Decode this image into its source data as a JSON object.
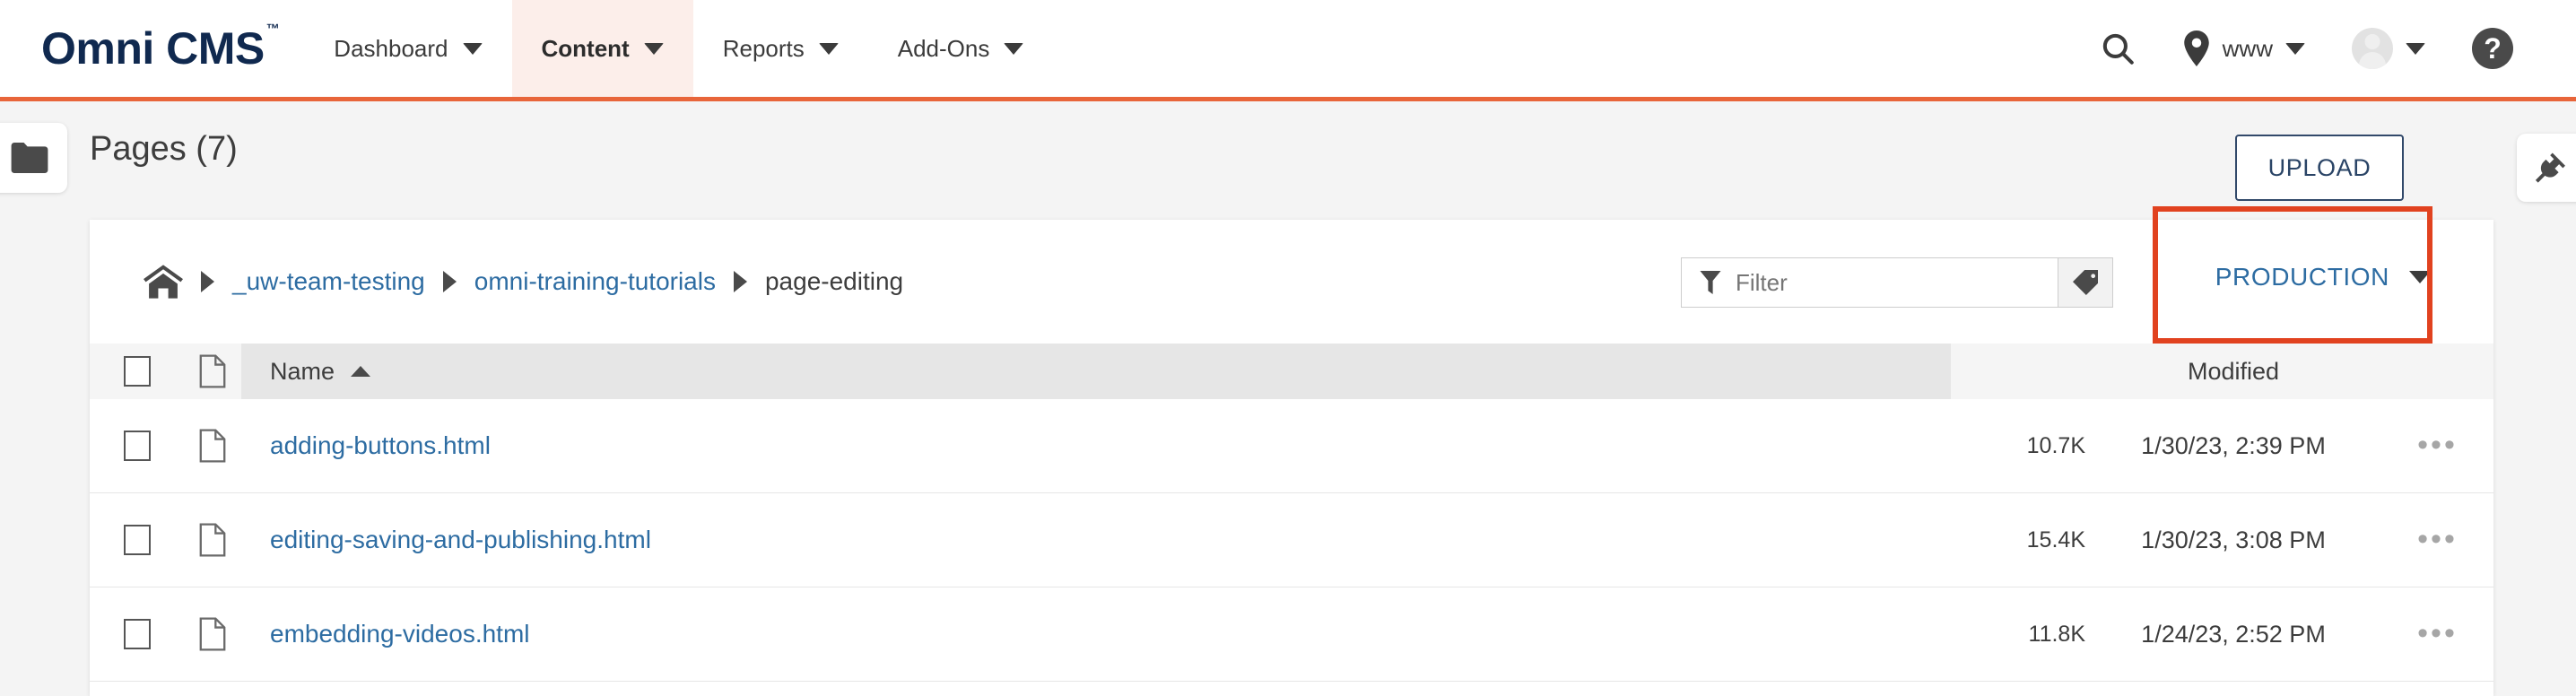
{
  "brand": {
    "name": "Omni CMS",
    "tm": "™"
  },
  "topnav": {
    "items": [
      {
        "label": "Dashboard",
        "active": false
      },
      {
        "label": "Content",
        "active": true
      },
      {
        "label": "Reports",
        "active": false
      },
      {
        "label": "Add-Ons",
        "active": false
      }
    ],
    "search_icon": "search-icon",
    "site_icon": "location-pin-icon",
    "site_label": "www",
    "avatar_icon": "user-avatar",
    "help_icon": "help-question-icon"
  },
  "toolbar": {
    "folder_icon": "folder-icon",
    "title": "Pages (7)",
    "upload_label": "UPLOAD",
    "plugin_icon": "plug-icon"
  },
  "breadcrumb": {
    "home_icon": "home-icon",
    "items": [
      {
        "label": "_uw-team-testing",
        "current": false
      },
      {
        "label": "omni-training-tutorials",
        "current": false
      },
      {
        "label": "page-editing",
        "current": true
      }
    ]
  },
  "filter": {
    "icon": "funnel-icon",
    "placeholder": "Filter",
    "value": "",
    "tag_icon": "tag-icon"
  },
  "environment": {
    "label": "PRODUCTION",
    "caret_icon": "chevron-down-icon",
    "highlight_color": "#e1421f"
  },
  "table": {
    "columns": {
      "name": "Name",
      "size": "",
      "modified": "Modified"
    },
    "sort_icon": "sort-ascending-icon",
    "rows": [
      {
        "name": "adding-buttons.html",
        "size": "10.7K",
        "modified": "1/30/23, 2:39 PM",
        "actions_icon": "more-options-icon"
      },
      {
        "name": "editing-saving-and-publishing.html",
        "size": "15.4K",
        "modified": "1/30/23, 3:08 PM",
        "actions_icon": "more-options-icon"
      },
      {
        "name": "embedding-videos.html",
        "size": "11.8K",
        "modified": "1/24/23, 2:52 PM",
        "actions_icon": "more-options-icon"
      }
    ]
  },
  "colors": {
    "brand_navy": "#10294f",
    "accent_orange": "#e8653a",
    "link_blue": "#2d6ca2",
    "tab_highlight": "#fceeea"
  }
}
